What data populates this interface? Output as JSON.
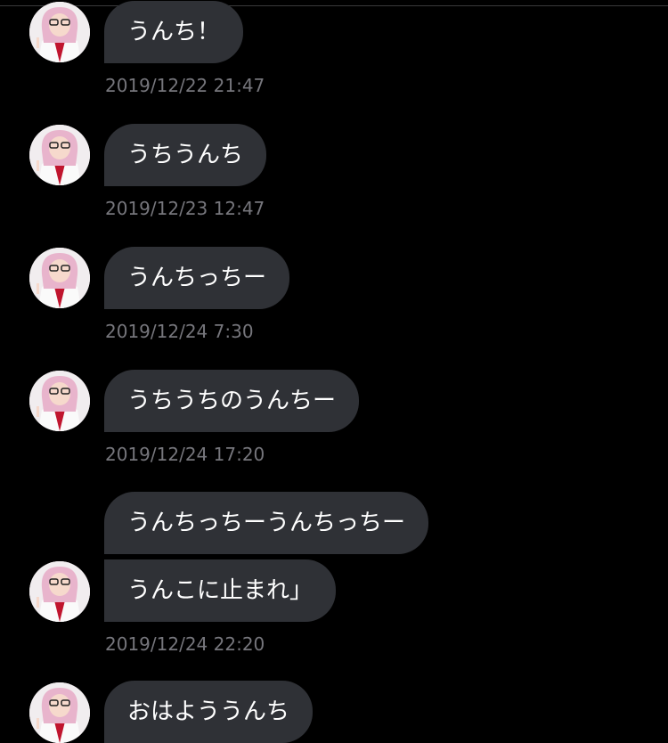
{
  "messages": [
    {
      "text": "うんち！",
      "timestamp": "2019/12/22 21:47"
    },
    {
      "text": "うちうんち",
      "timestamp": "2019/12/23 12:47"
    },
    {
      "text": "うんちっちー",
      "timestamp": "2019/12/24 7:30"
    },
    {
      "text": "うちうちのうんちー",
      "timestamp": "2019/12/24 17:20"
    },
    {
      "lines": [
        "うんちっちーうんちっちー",
        "うんこに止まれ」"
      ],
      "timestamp": "2019/12/24 22:20"
    },
    {
      "text": "おはよううんち",
      "timestamp": ""
    }
  ],
  "colors": {
    "background": "#000000",
    "bubble": "#2f3136",
    "bubble_text": "#ffffff",
    "timestamp": "#76767c"
  },
  "avatar_icon": "user-avatar-icon"
}
